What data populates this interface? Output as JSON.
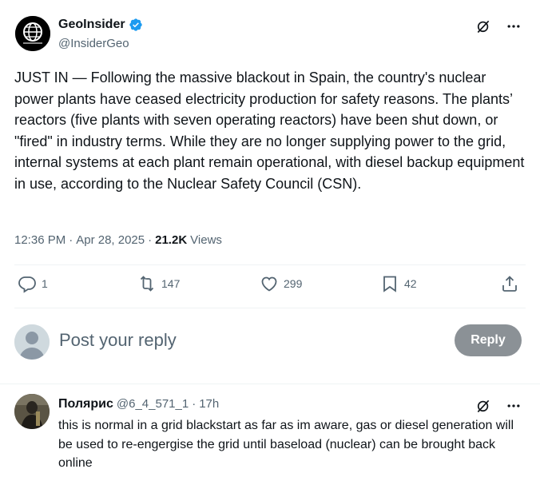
{
  "tweet": {
    "author_name": "GeoInsider",
    "author_handle": "@InsiderGeo",
    "text": "JUST IN — Following the massive blackout in Spain, the country's nuclear power plants have ceased electricity production for safety reasons. The plants’ reactors (five plants with seven operating reactors) have been shut down, or \"fired\" in industry terms. While they are no longer supplying power to the grid, internal systems at each plant remain operational, with diesel backup equipment in use, according to the Nuclear Safety Council (CSN).",
    "time": "12:36 PM",
    "date": "Apr 28, 2025",
    "separator": "·",
    "views_count": "21.2K",
    "views_label": "Views",
    "icons": {
      "grok": "grok-icon",
      "more": "more-icon",
      "verified": "verified-badge-icon"
    },
    "colors": {
      "verified": "#1d9bf0",
      "secondary_text": "#536471"
    }
  },
  "actions": {
    "replies": "1",
    "reposts": "147",
    "likes": "299",
    "bookmarks": "42"
  },
  "compose": {
    "placeholder": "Post your reply",
    "button_label": "Reply"
  },
  "reply": {
    "name": "Полярис",
    "handle": "@6_4_571_1",
    "separator": "·",
    "time": "17h",
    "text": "this is normal in a grid blackstart as far as im aware, gas or diesel generation will be used to re-engergise the grid until baseload (nuclear) can be brought back online"
  }
}
